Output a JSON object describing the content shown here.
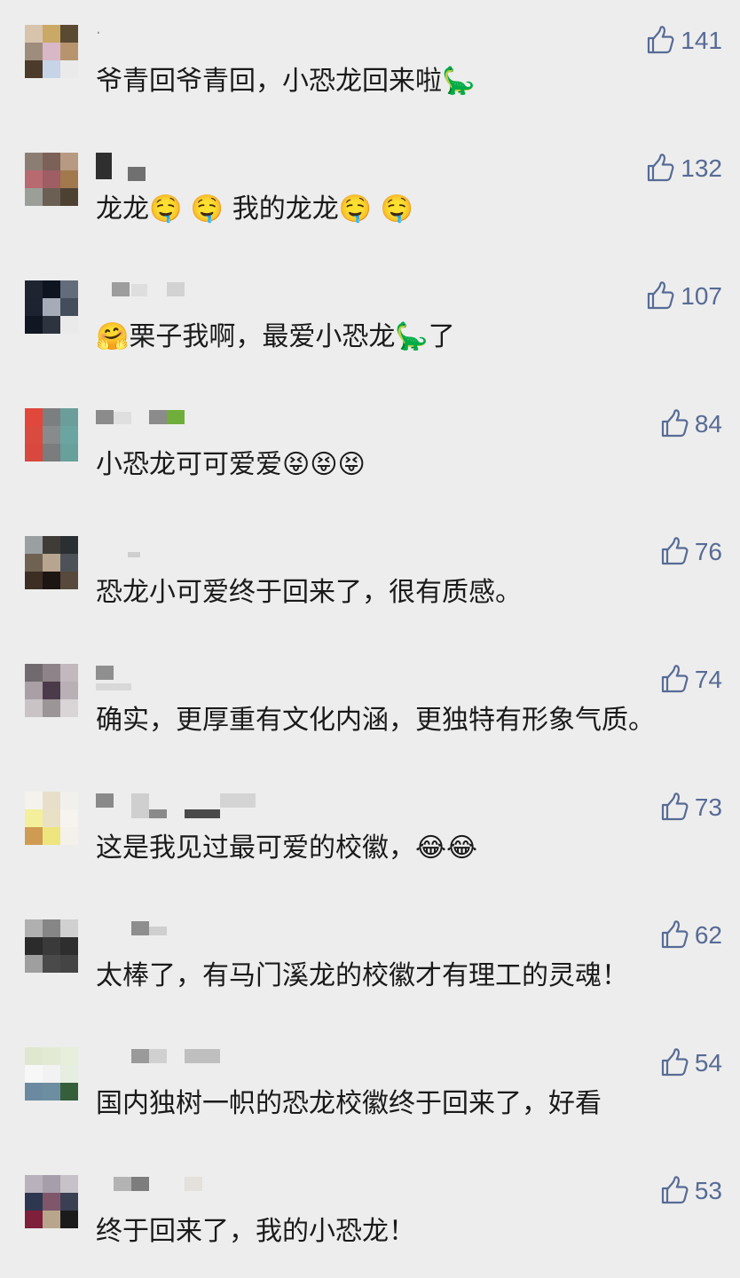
{
  "colors": {
    "background": "#ededed",
    "text": "#1a1a1a",
    "like": "#576b95"
  },
  "icons": {
    "like": "thumbs-up-icon"
  },
  "comments": [
    {
      "nickname": ".",
      "text": "爷青回爷青回，小恐龙回来啦🦕",
      "likes": "141",
      "avatar": [
        "#d8c3ad",
        "#c9a965",
        "#5a4a31",
        "#9e8d7d",
        "#d8b7c7",
        "#b7946d",
        "#4c3a2a",
        "#c7d4e7",
        "#eaeaea"
      ]
    },
    {
      "nickname": "",
      "text": "龙龙🤤 🤤 我的龙龙🤤 🤤",
      "likes": "132",
      "avatar": [
        "#8c7d73",
        "#7b6158",
        "#b79a81",
        "#b76a6f",
        "#9f5d64",
        "#a2784d",
        "#9c9f98",
        "#6b5e53",
        "#4d4132"
      ]
    },
    {
      "nickname": "",
      "text": "🤗栗子我啊，最爱小恐龙🦕了",
      "likes": "107",
      "avatar": [
        "#1e2531",
        "#0f1520",
        "#636c7a",
        "#1d2330",
        "#a5acb8",
        "#444d5c",
        "#101722",
        "#2d3440",
        "#eaeaea"
      ]
    },
    {
      "nickname": "",
      "text": "小恐龙可可爱爱😝😝😝",
      "likes": "84",
      "avatar": [
        "#e1473a",
        "#7c7f80",
        "#6b9e9a",
        "#d94b3f",
        "#888b8b",
        "#6aa5a1",
        "#d8483e",
        "#7a7c7d",
        "#68a09b"
      ]
    },
    {
      "nickname": "",
      "text": "恐龙小可爱终于回来了，很有质感。",
      "likes": "76",
      "avatar": [
        "#9aa0a2",
        "#3f3c37",
        "#2a2f33",
        "#6f6253",
        "#b8a58f",
        "#4c5258",
        "#3c2e23",
        "#1d1512",
        "#57493c"
      ]
    },
    {
      "nickname": "",
      "text": "确实，更厚重有文化内涵，更独特有形象气质。",
      "likes": "74",
      "avatar": [
        "#706a6e",
        "#8d8388",
        "#c2b8bd",
        "#a99fa4",
        "#4b3b4a",
        "#b8b0b4",
        "#c9c3c6",
        "#9b9598",
        "#d9d4d6"
      ]
    },
    {
      "nickname": "",
      "text": "这是我见过最可爱的校徽，😂😂",
      "likes": "73",
      "avatar": [
        "#f5f2ed",
        "#e7dfca",
        "#f2f0ec",
        "#f3ef9b",
        "#e9e1c5",
        "#f7f4ef",
        "#cf9b53",
        "#eee57e",
        "#f4f1ea"
      ]
    },
    {
      "nickname": "",
      "text": "太棒了，有马门溪龙的校徽才有理工的灵魂！",
      "likes": "62",
      "avatar": [
        "#b0b0b0",
        "#868686",
        "#d0d0d0",
        "#2b2b2b",
        "#3a3a3a",
        "#2e2e2e",
        "#9f9f9f",
        "#4a4a4a",
        "#444444"
      ]
    },
    {
      "nickname": "",
      "text": "国内独树一帜的恐龙校徽终于回来了，好看",
      "likes": "54",
      "avatar": [
        "#dfe8cf",
        "#e2ead4",
        "#e7efdb",
        "#f7f7f7",
        "#f2f2f2",
        "#e5eee0",
        "#6b8aa1",
        "#6c8ea0",
        "#355f3a"
      ]
    },
    {
      "nickname": "",
      "text": "终于回来了，我的小恐龙！",
      "likes": "53",
      "avatar": [
        "#b9b2bc",
        "#a69eab",
        "#c7c1ca",
        "#2e3750",
        "#80576a",
        "#3b3f54",
        "#7e1f3c",
        "#b9a58b",
        "#1b1b1b"
      ]
    }
  ]
}
